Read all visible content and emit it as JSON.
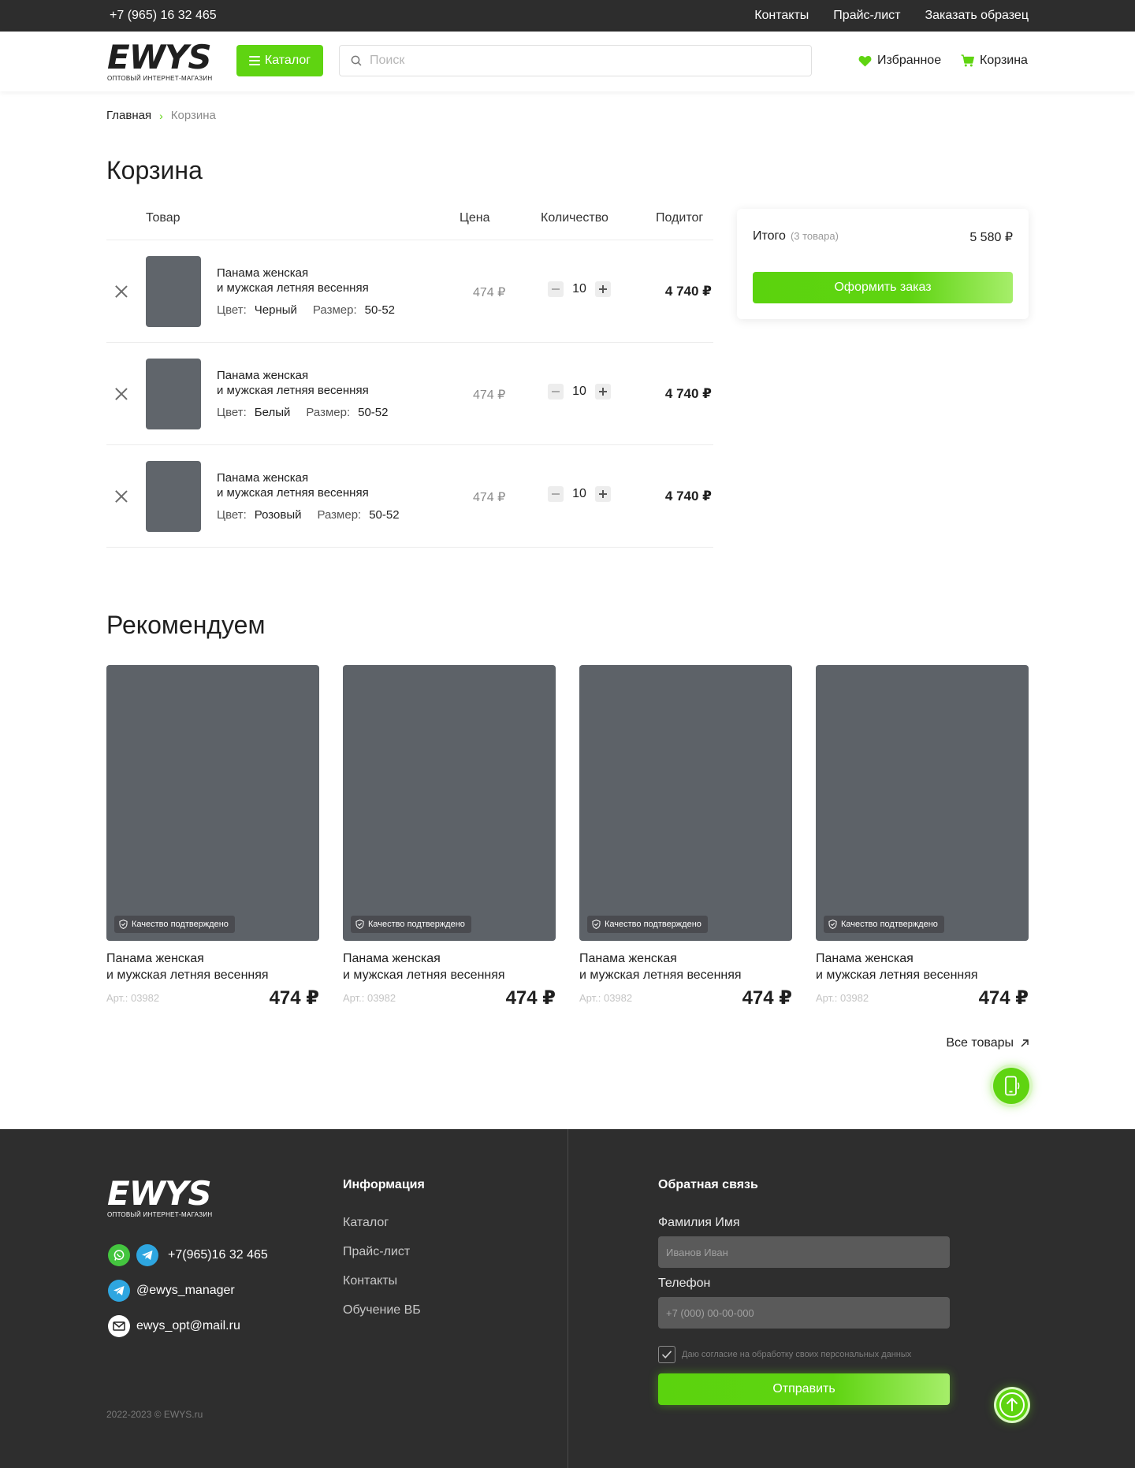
{
  "topbar": {
    "phone": "+7 (965) 16 32 465",
    "links": [
      "Контакты",
      "Прайс-лист",
      "Заказать образец"
    ]
  },
  "header": {
    "logo_text": "EWYS",
    "logo_sub": "ОПТОВЫЙ ИНТЕРНЕТ-МАГАЗИН",
    "catalog_label": "Каталог",
    "search_placeholder": "Поиск",
    "favorites_label": "Избранное",
    "cart_label": "Корзина"
  },
  "breadcrumb": {
    "home": "Главная",
    "current": "Корзина"
  },
  "page_title": "Корзина",
  "cart": {
    "columns": {
      "product": "Товар",
      "price": "Цена",
      "quantity": "Количество",
      "subtotal": "Подитог"
    },
    "items": [
      {
        "name_line1": "Панама женская",
        "name_line2": "и мужская летняя весенняя",
        "color_label": "Цвет:",
        "color": "Черный",
        "size_label": "Размер:",
        "size": "50-52",
        "price": "474 ₽",
        "qty": "10",
        "subtotal": "4 740 ₽"
      },
      {
        "name_line1": "Панама женская",
        "name_line2": "и мужская летняя весенняя",
        "color_label": "Цвет:",
        "color": "Белый",
        "size_label": "Размер:",
        "size": "50-52",
        "price": "474 ₽",
        "qty": "10",
        "subtotal": "4 740 ₽"
      },
      {
        "name_line1": "Панама женская",
        "name_line2": "и мужская летняя весенняя",
        "color_label": "Цвет:",
        "color": "Розовый",
        "size_label": "Размер:",
        "size": "50-52",
        "price": "474 ₽",
        "qty": "10",
        "subtotal": "4 740 ₽"
      }
    ]
  },
  "summary": {
    "label": "Итого",
    "count": "(3 товара)",
    "total": "5 580 ₽",
    "order_button": "Оформить заказ"
  },
  "recommend": {
    "title": "Рекомендуем",
    "badge": "Качество подтверждено",
    "products": [
      {
        "name_line1": "Панама женская",
        "name_line2": "и мужская летняя весенняя",
        "article": "Арт.: 03982",
        "price": "474 ₽"
      },
      {
        "name_line1": "Панама женская",
        "name_line2": "и мужская летняя весенняя",
        "article": "Арт.: 03982",
        "price": "474 ₽"
      },
      {
        "name_line1": "Панама женская",
        "name_line2": "и мужская летняя весенняя",
        "article": "Арт.: 03982",
        "price": "474 ₽"
      },
      {
        "name_line1": "Панама женская",
        "name_line2": "и мужская летняя весенняя",
        "article": "Арт.: 03982",
        "price": "474 ₽"
      }
    ],
    "all_goods": "Все товары"
  },
  "footer": {
    "logo_text": "EWYS",
    "logo_sub": "ОПТОВЫЙ ИНТЕРНЕТ-МАГАЗИН",
    "phone": "+7(965)16 32 465",
    "telegram": "@ewys_manager",
    "email": "ewys_opt@mail.ru",
    "copyright": "2022-2023 © EWYS.ru",
    "info_title": "Информация",
    "info_links": [
      "Каталог",
      "Прайс-лист",
      "Контакты",
      "Обучение ВБ"
    ],
    "feedback_title": "Обратная связь",
    "name_label": "Фамилия Имя",
    "name_placeholder": "Иванов Иван",
    "phone_label": "Телефон",
    "phone_placeholder": "+7 (000) 00-00-000",
    "consent": "Даю согласие на обработку своих персональных данных",
    "send_button": "Отправить"
  },
  "colors": {
    "accent": "#5fd411",
    "dark": "#2e2e2e",
    "telegram": "#2ea6e0",
    "whatsapp": "#44c53f"
  },
  "icons": [
    "menu-icon",
    "search-icon",
    "heart-icon",
    "cart-icon",
    "close-icon",
    "minus-icon",
    "plus-icon",
    "shield-check-icon",
    "arrow-up-right-icon",
    "phone-icon",
    "whatsapp-icon",
    "telegram-icon",
    "mail-icon",
    "check-icon",
    "arrow-up-icon"
  ]
}
